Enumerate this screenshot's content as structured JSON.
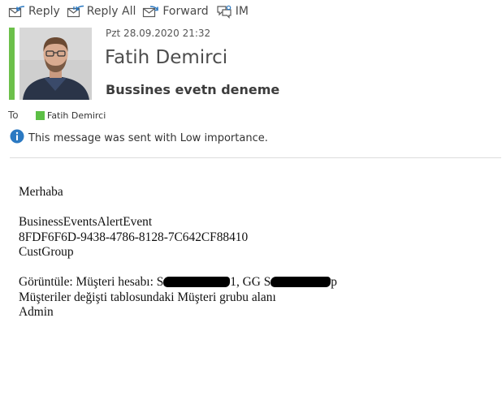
{
  "toolbar": {
    "reply_label": "Reply",
    "reply_all_label": "Reply All",
    "forward_label": "Forward",
    "im_label": "IM"
  },
  "header": {
    "date": "Pzt 28.09.2020 21:32",
    "sender_name": "Fatih Demirci",
    "subject": "Bussines evetn deneme",
    "to_label": "To",
    "recipient_name": "Fatih Demirci",
    "importance_notice": "This message was sent with Low importance."
  },
  "colors": {
    "accent": "#6cc04a",
    "presence": "#5cbf45",
    "info_icon": "#2b79c2"
  },
  "body": {
    "greeting": "Merhaba",
    "event_name": "BusinessEventsAlertEvent",
    "event_id": "8FDF6F6D-9438-4786-8128-7C642CF88410",
    "table_name": "CustGroup",
    "view_prefix": "Görüntüle: Müşteri hesabı: ",
    "view_account_visible_start": "S",
    "view_account_visible_end": "1, GG ",
    "view_group_visible_start": "S",
    "view_group_visible_end": "p",
    "description": "Müşteriler değişti tablosundaki Müşteri grubu alanı",
    "user": "Admin"
  }
}
